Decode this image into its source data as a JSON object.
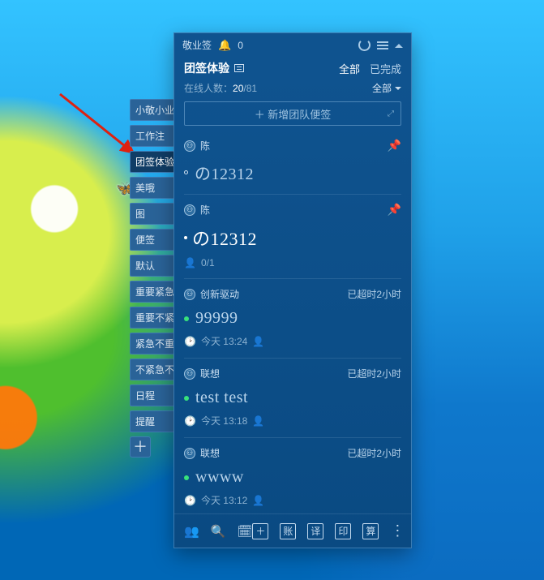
{
  "app_name": "敬业签",
  "notifications_count": "0",
  "board": {
    "title": "团签体验",
    "tab_all": "全部",
    "tab_done": "已完成",
    "active_tab": "全部",
    "online_label": "在线人数：",
    "online_current": "20",
    "online_total": "/81",
    "filter": "全部"
  },
  "new_note_btn": "＋ 新增团队便签",
  "left_tabs": [
    "小敬小业",
    "工作注",
    "团签体验",
    "美哦",
    "图",
    "便签",
    "默认",
    "重要紧急",
    "重要不紧急",
    "紧急不重要",
    "不紧急不重要",
    "日程",
    "提醒"
  ],
  "left_tabs_active_index": 2,
  "items": [
    {
      "author": "陈",
      "pinned": true,
      "status": "",
      "dot": "outline",
      "text": "の12312",
      "meta_icon": "",
      "meta_text": ""
    },
    {
      "author": "陈",
      "pinned": true,
      "status": "",
      "dot": "outline",
      "text": "の12312",
      "meta_icon": "person",
      "meta_text": "0/1",
      "big": true,
      "leading_dot": true
    },
    {
      "author": "创新驱动",
      "pinned": false,
      "status": "已超时2小时",
      "dot": "green",
      "text": "99999",
      "meta_icon": "clock",
      "meta_text": "今天 13:24",
      "meta_suffix": "person"
    },
    {
      "author": "联想",
      "pinned": false,
      "status": "已超时2小时",
      "dot": "green",
      "text": "test test",
      "meta_icon": "clock",
      "meta_text": "今天 13:18",
      "meta_suffix": "person"
    },
    {
      "author": "联想",
      "pinned": false,
      "status": "已超时2小时",
      "dot": "green",
      "text": "wwww",
      "meta_icon": "clock",
      "meta_text": "今天 13:12",
      "meta_suffix": "person"
    }
  ],
  "footer": {
    "btn_plus": "＋",
    "btn_account": "账",
    "btn_translate": "译",
    "btn_stamp": "印",
    "btn_calc": "算"
  }
}
